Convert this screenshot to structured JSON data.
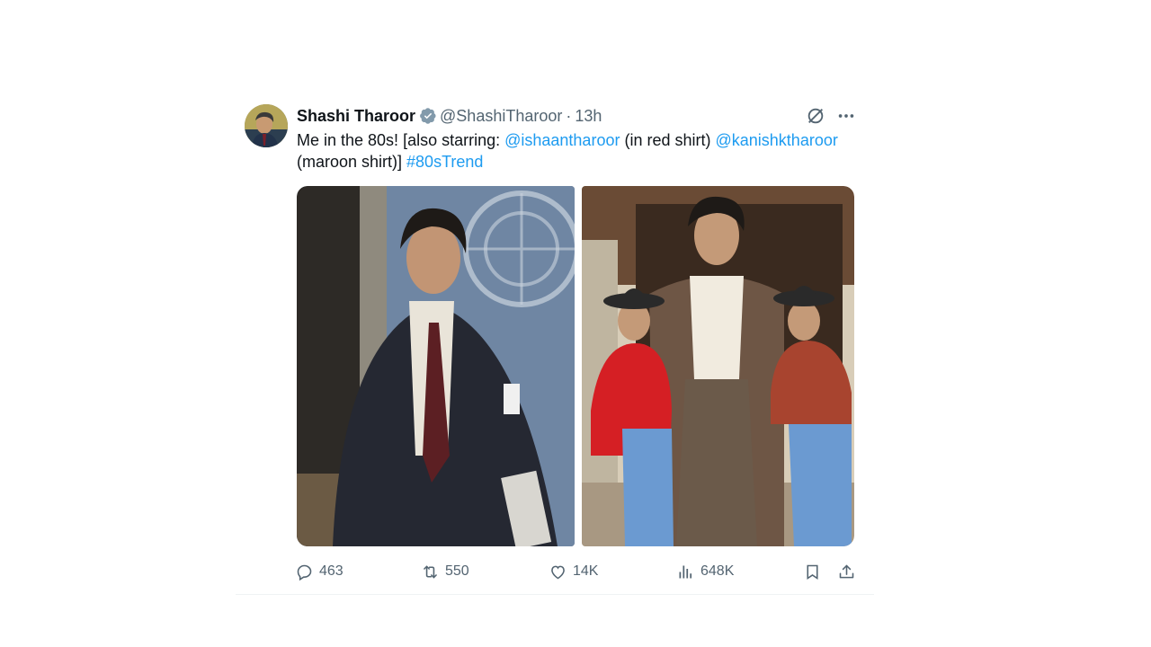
{
  "tweet": {
    "author_name": "Shashi Tharoor",
    "handle": "@ShashiTharoor",
    "separator": "·",
    "time": "13h",
    "text_parts": {
      "p1": "Me in the 80s! [also starring: ",
      "mention1": "@ishaantharoor",
      "p2": " (in red shirt) ",
      "mention2": "@kanishktharoor",
      "p3": " (maroon shirt)] ",
      "hashtag": "#80sTrend"
    },
    "stats": {
      "replies": "463",
      "retweets": "550",
      "likes": "14K",
      "views": "648K"
    }
  },
  "icons": {
    "verified": "verified-badge-icon",
    "grok": "grok-icon",
    "more": "more-icon",
    "reply": "reply-icon",
    "retweet": "retweet-icon",
    "like": "like-icon",
    "views": "views-icon",
    "bookmark": "bookmark-icon",
    "share": "share-icon"
  },
  "colors": {
    "link": "#1d9bf0",
    "secondary_text": "#536471",
    "verified": "#829aab"
  }
}
